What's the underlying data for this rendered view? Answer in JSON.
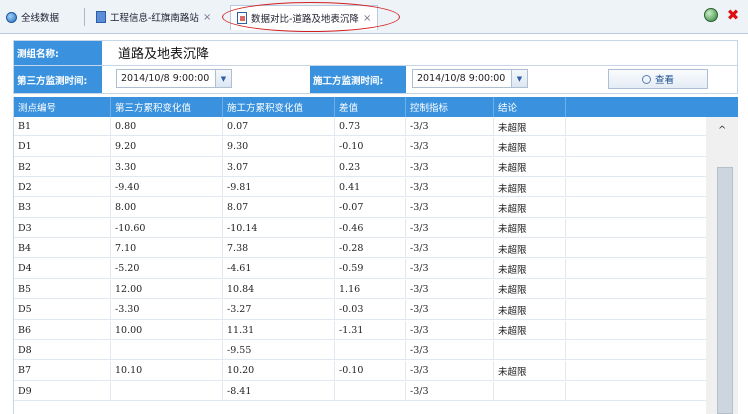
{
  "tabs": [
    {
      "label": "全线数据",
      "icon": "globe-icon"
    },
    {
      "label": "工程信息-红旗南路站",
      "icon": "document-icon",
      "closable": true
    },
    {
      "label": "数据对比-道路及地表沉降",
      "icon": "compare-document-icon",
      "closable": true,
      "active": true
    }
  ],
  "close_glyph": "×",
  "toolbar": {
    "refresh_icon": "globe-refresh-icon",
    "close_icon": "close-icon",
    "close_glyph": "✖"
  },
  "form": {
    "group_label": "测组名称:",
    "group_value": "道路及地表沉降",
    "third_time_label": "第三方监测时间:",
    "third_time_value": "2014/10/8 9:00:00",
    "constr_time_label": "施工方监测时间:",
    "constr_time_value": "2014/10/8 9:00:00",
    "dropdown_glyph": "▼",
    "query_label": "查看"
  },
  "table": {
    "columns": [
      "测点编号",
      "第三方累积变化值",
      "施工方累积变化值",
      "差值",
      "控制指标",
      "结论"
    ],
    "rows": [
      [
        "B1",
        "0.80",
        "0.07",
        "0.73",
        "-3/3",
        "未超限"
      ],
      [
        "D1",
        "9.20",
        "9.30",
        "-0.10",
        "-3/3",
        "未超限"
      ],
      [
        "B2",
        "3.30",
        "3.07",
        "0.23",
        "-3/3",
        "未超限"
      ],
      [
        "D2",
        "-9.40",
        "-9.81",
        "0.41",
        "-3/3",
        "未超限"
      ],
      [
        "B3",
        "8.00",
        "8.07",
        "-0.07",
        "-3/3",
        "未超限"
      ],
      [
        "D3",
        "-10.60",
        "-10.14",
        "-0.46",
        "-3/3",
        "未超限"
      ],
      [
        "B4",
        "7.10",
        "7.38",
        "-0.28",
        "-3/3",
        "未超限"
      ],
      [
        "D4",
        "-5.20",
        "-4.61",
        "-0.59",
        "-3/3",
        "未超限"
      ],
      [
        "B5",
        "12.00",
        "10.84",
        "1.16",
        "-3/3",
        "未超限"
      ],
      [
        "D5",
        "-3.30",
        "-3.27",
        "-0.03",
        "-3/3",
        "未超限"
      ],
      [
        "B6",
        "10.00",
        "11.31",
        "-1.31",
        "-3/3",
        "未超限"
      ],
      [
        "D8",
        "",
        "-9.55",
        "",
        "-3/3",
        ""
      ],
      [
        "B7",
        "10.10",
        "10.20",
        "-0.10",
        "-3/3",
        "未超限"
      ],
      [
        "D9",
        "",
        "-8.41",
        "",
        "-3/3",
        ""
      ]
    ]
  },
  "scroll_up_glyph": "^",
  "colors": {
    "header_blue": "#3a92df",
    "highlight_ring": "#d2201f"
  }
}
